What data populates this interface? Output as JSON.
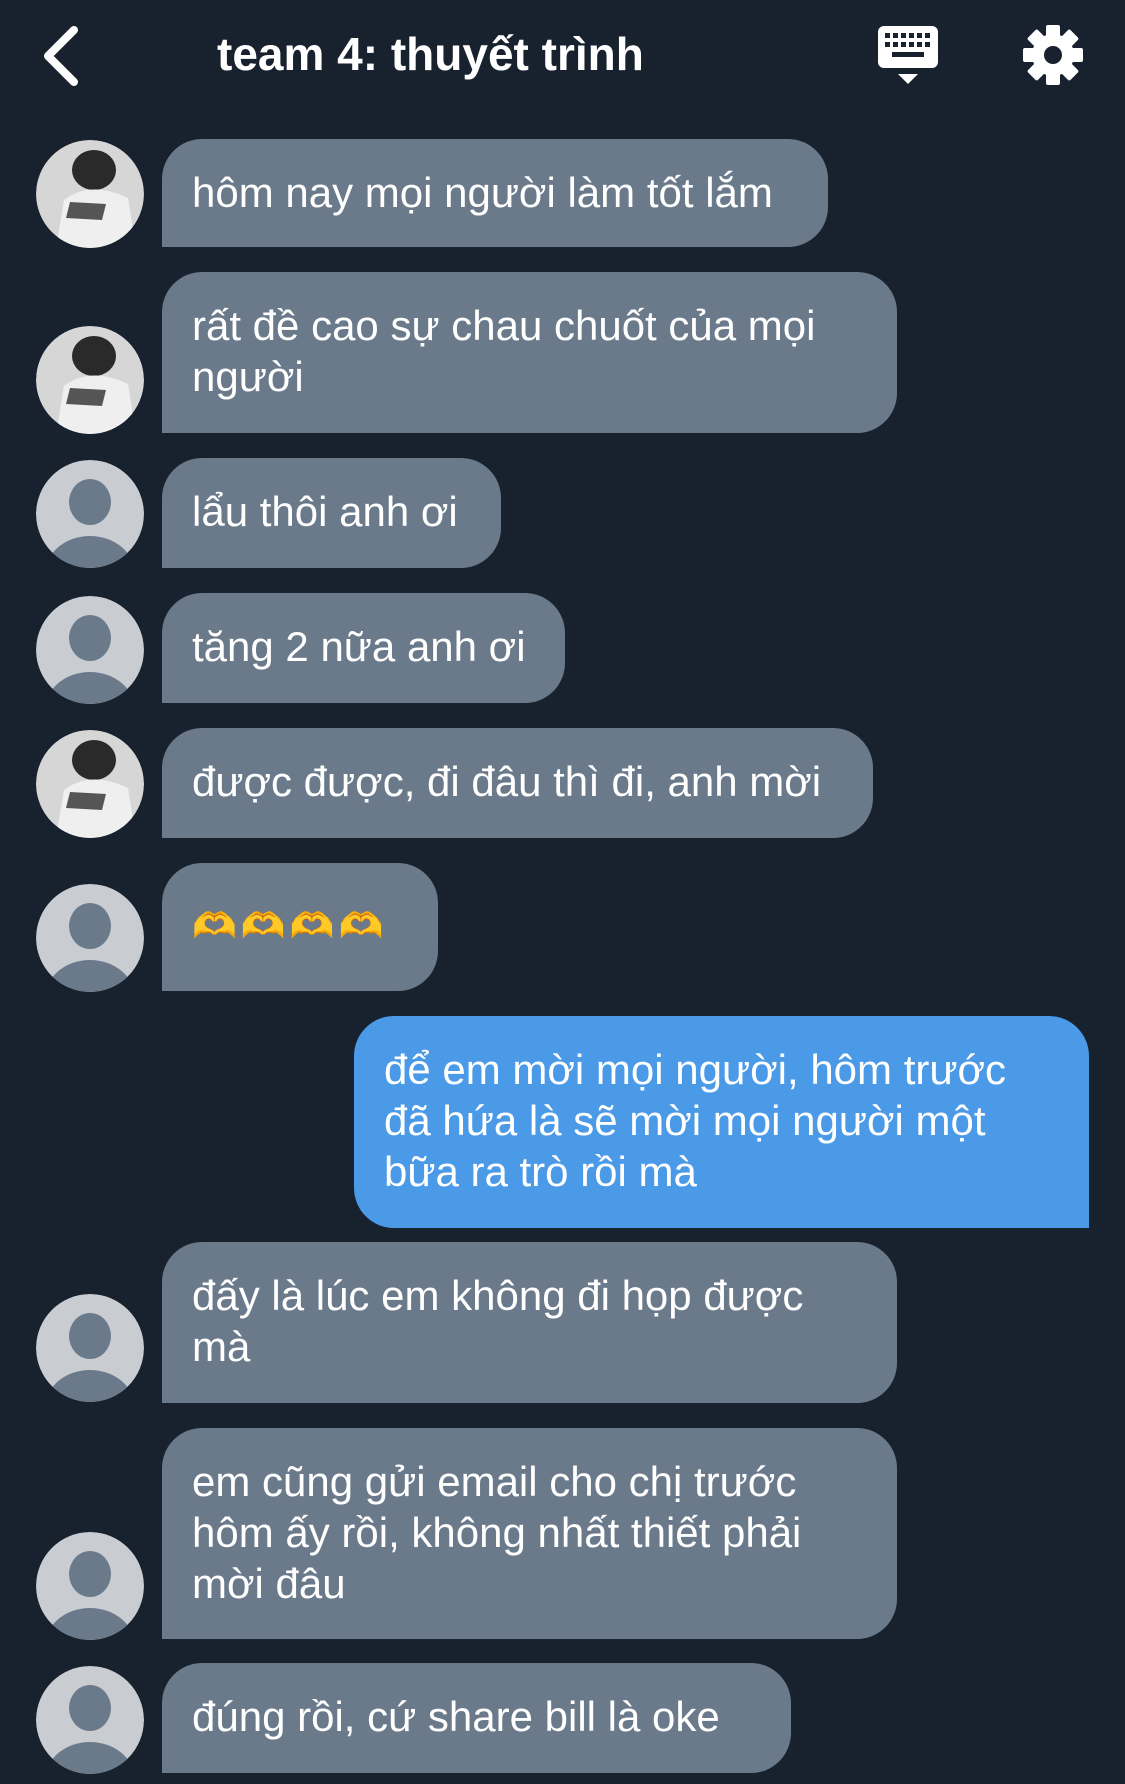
{
  "header": {
    "title": "team 4: thuyết trình",
    "back_icon": "chevron-left-icon",
    "keyboard_icon": "keyboard-icon",
    "settings_icon": "gear-icon"
  },
  "colors": {
    "background": "#18212e",
    "incoming_bubble": "#6b7a8b",
    "outgoing_bubble": "#4a9ae8",
    "text": "#ffffff"
  },
  "messages": [
    {
      "direction": "in",
      "avatar": "photo",
      "text": "hôm nay mọi người làm tốt lắm"
    },
    {
      "direction": "in",
      "avatar": "photo",
      "text": "rất đề cao sự chau chuốt của mọi người"
    },
    {
      "direction": "in",
      "avatar": "default",
      "text": "lẩu thôi anh ơi"
    },
    {
      "direction": "in",
      "avatar": "default",
      "text": "tăng 2 nữa anh ơi"
    },
    {
      "direction": "in",
      "avatar": "photo",
      "text": "được được, đi đâu thì đi, anh mời"
    },
    {
      "direction": "in",
      "avatar": "default",
      "text": "🫶🫶🫶🫶"
    },
    {
      "direction": "out",
      "avatar": "",
      "text": "để em mời mọi người, hôm trước đã hứa là sẽ mời mọi người một bữa ra trò rồi mà"
    },
    {
      "direction": "in",
      "avatar": "default",
      "text": "đấy là lúc em không đi họp được mà"
    },
    {
      "direction": "in",
      "avatar": "default",
      "text": "em cũng gửi email cho chị trước hôm ấy rồi, không nhất thiết phải mời đâu"
    },
    {
      "direction": "in",
      "avatar": "default",
      "text": "đúng rồi, cứ share bill là oke"
    }
  ]
}
